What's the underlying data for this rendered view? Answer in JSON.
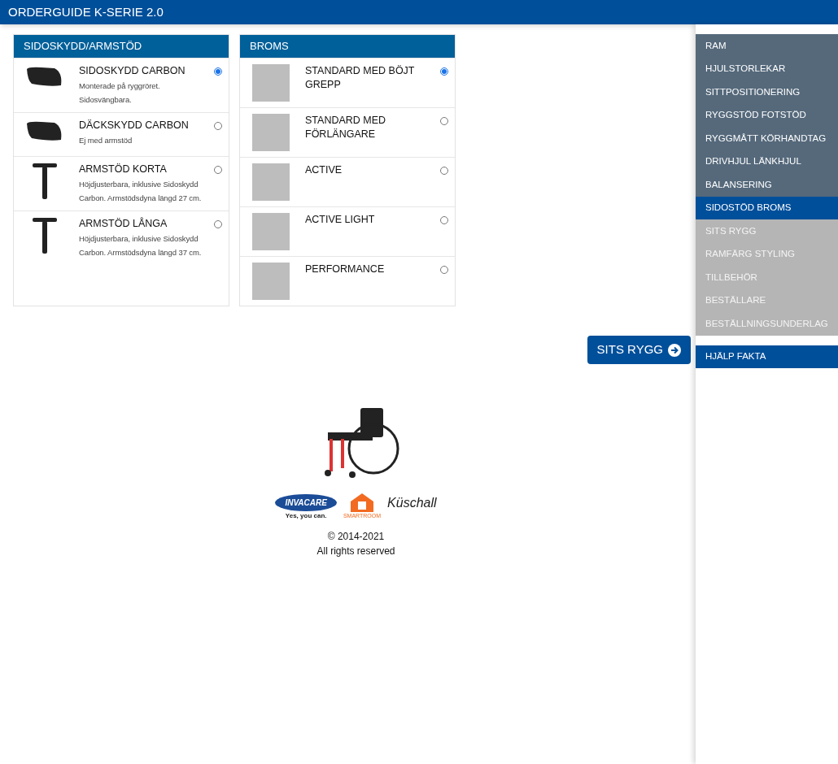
{
  "header": {
    "title": "ORDERGUIDE K-SERIE 2.0"
  },
  "panels": [
    {
      "title": "SIDOSKYDD/ARMSTÖD",
      "options": [
        {
          "name": "SIDOSKYDD CARBON",
          "description": "Monterade på ryggröret. Sidosvängbara.",
          "selected": true,
          "kind": "guard"
        },
        {
          "name": "DÄCKSKYDD CARBON",
          "description": "Ej med armstöd",
          "selected": false,
          "kind": "guard"
        },
        {
          "name": "ARMSTÖD KORTA",
          "description": "Höjdjusterbara, inklusive Sidoskydd Carbon. Armstödsdyna längd 27 cm.",
          "selected": false,
          "kind": "armrest"
        },
        {
          "name": "ARMSTÖD LÅNGA",
          "description": "Höjdjusterbara, inklusive Sidoskydd Carbon. Armstödsdyna längd 37 cm.",
          "selected": false,
          "kind": "armrest"
        }
      ]
    },
    {
      "title": "BROMS",
      "options": [
        {
          "name": "STANDARD MED BÖJT GREPP",
          "selected": true,
          "kind": "photo"
        },
        {
          "name": "STANDARD MED FÖRLÄNGARE",
          "selected": false,
          "kind": "photo"
        },
        {
          "name": "ACTIVE",
          "selected": false,
          "kind": "photo"
        },
        {
          "name": "ACTIVE LIGHT",
          "selected": false,
          "kind": "photo"
        },
        {
          "name": "PERFORMANCE",
          "selected": false,
          "kind": "photo"
        }
      ]
    }
  ],
  "next_button": {
    "label": "SITS RYGG"
  },
  "footer": {
    "logos": {
      "invacare": "INVACARE",
      "invacare_tagline": "Yes, you can.",
      "smartroom": "SMARTROOM",
      "kuschall": "Küschall"
    },
    "copyright": "© 2014-2021",
    "rights": "All rights reserved"
  },
  "sidebar": {
    "items": [
      {
        "label": "RAM",
        "kind": "done",
        "selected": false
      },
      {
        "label": "HJULSTORLEKAR",
        "kind": "done",
        "selected": false
      },
      {
        "label": "SITTPOSITIONERING",
        "kind": "done",
        "selected": false
      },
      {
        "label": "RYGGSTÖD FOTSTÖD",
        "kind": "done",
        "selected": false
      },
      {
        "label": "RYGGMÅTT KÖRHANDTAG",
        "kind": "done",
        "selected": false
      },
      {
        "label": "DRIVHJUL LÄNKHJUL",
        "kind": "done",
        "selected": false
      },
      {
        "label": "BALANSERING",
        "kind": "done",
        "selected": false
      },
      {
        "label": "SIDOSTÖD BROMS",
        "kind": "done",
        "selected": true
      },
      {
        "label": "SITS RYGG",
        "kind": "pending",
        "selected": false
      },
      {
        "label": "RAMFÄRG STYLING",
        "kind": "pending",
        "selected": false
      },
      {
        "label": "TILLBEHÖR",
        "kind": "pending",
        "selected": false
      },
      {
        "label": "BESTÄLLARE",
        "kind": "pending",
        "selected": false
      },
      {
        "label": "BESTÄLLNINGSUNDERLAG",
        "kind": "pending",
        "selected": false
      }
    ],
    "help": {
      "label": "HJÄLP FAKTA"
    }
  }
}
